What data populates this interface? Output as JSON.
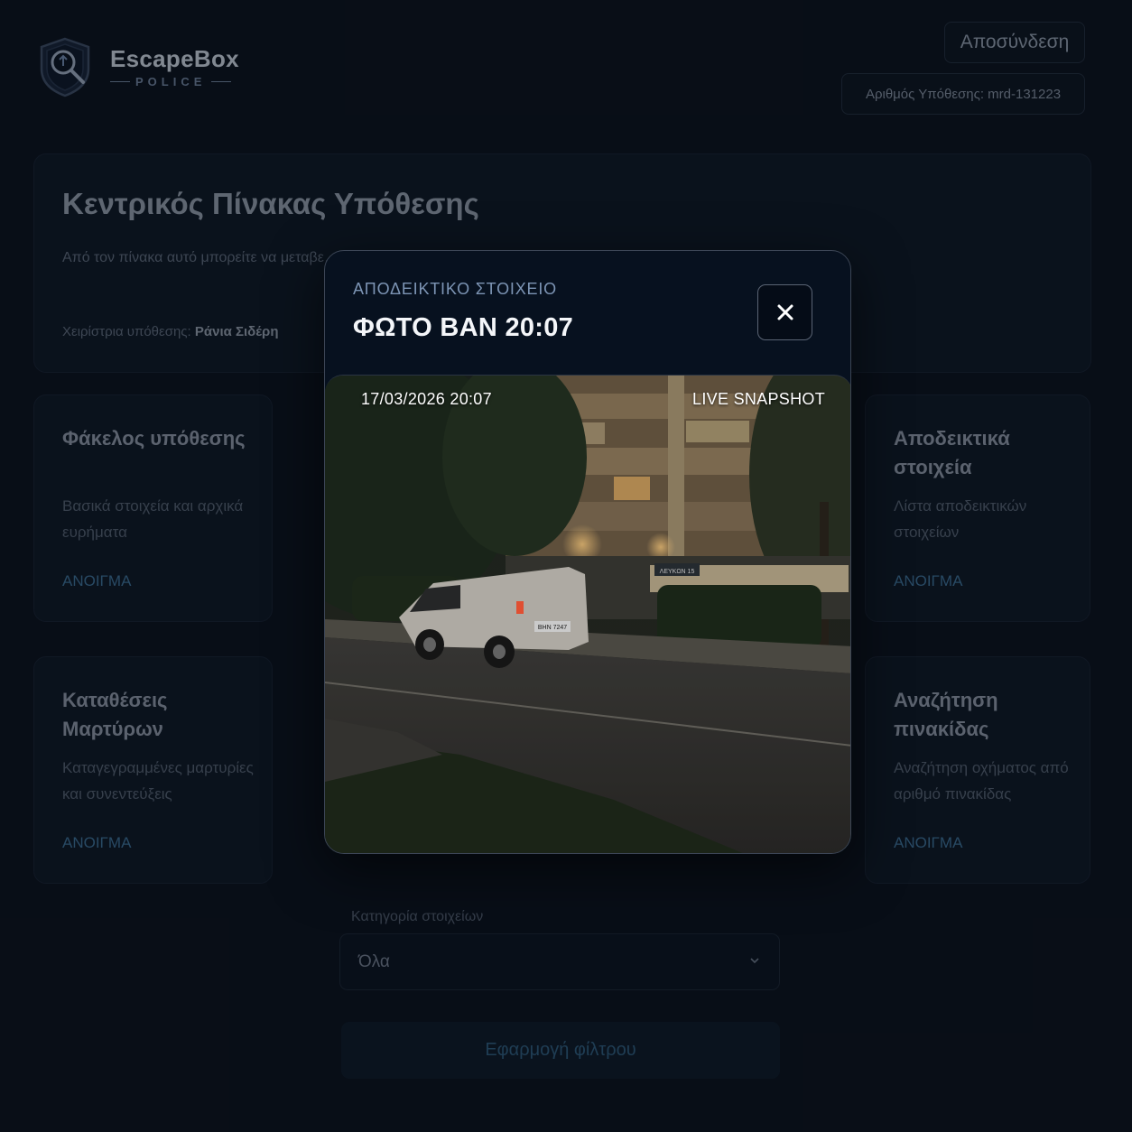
{
  "brand": {
    "name": "EscapeBox",
    "sub": "POLICE"
  },
  "header": {
    "logout_label": "Αποσύνδεση",
    "case_number": "Αριθμός Υπόθεσης: mrd-131223"
  },
  "dashboard": {
    "title": "Κεντρικός Πίνακας Υπόθεσης",
    "description": "Από τον πίνακα αυτό μπορείτε να μεταβε… διαθέσιμες ενότητες έρευνας της υπόθε…",
    "manager_label": "Χειρίστρια υπόθεσης:",
    "manager_name": "Ράνια Σιδέρη"
  },
  "cards": [
    {
      "title": "Φάκελος υπόθεσης",
      "desc": "Βασικά στοιχεία και αρχικά ευρήματα",
      "link": "ΑΝΟΙΓΜΑ"
    },
    {
      "title": "Αποδεικτικά στοιχεία",
      "desc": "Λίστα αποδεικτικών στοιχείων",
      "link": "ΑΝΟΙΓΜΑ"
    },
    {
      "title": "Καταθέσεις Μαρτύρων",
      "desc": "Καταγεγραμμένες μαρτυρίες και συνεντεύξεις",
      "link": "ΑΝΟΙΓΜΑ"
    },
    {
      "title": "Αναζήτηση πινακίδας",
      "desc": "Αναζήτηση οχήματος από αριθμό πινακίδας",
      "link": "ΑΝΟΙΓΜΑ"
    }
  ],
  "filter": {
    "label": "Κατηγορία στοιχείων",
    "selected": "Όλα",
    "apply_label": "Εφαρμογή φίλτρου"
  },
  "modal": {
    "eyebrow": "ΑΠΟΔΕΙΚΤΙΚΟ ΣΤΟΙΧΕΙΟ",
    "title": "ΦΩΤΟ ΒΑΝ 20:07",
    "close_symbol": "✕",
    "timestamp": "17/03/2026  20:07",
    "live_label": "LIVE SNAPSHOT",
    "plate": "ΒΗΝ 7247",
    "street_sign": "ΛΕΥΚΩΝ 15"
  }
}
